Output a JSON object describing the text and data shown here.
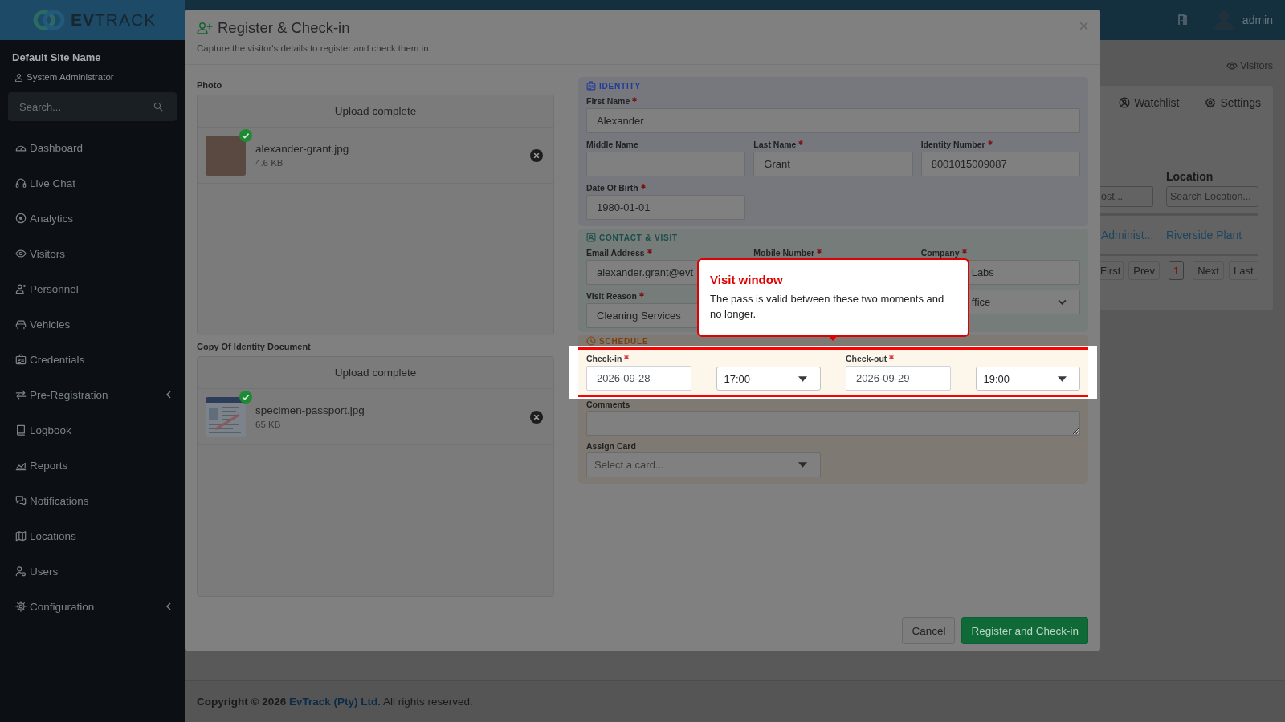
{
  "sidebar": {
    "brand": "**EV**TRACK",
    "site_name": "Default Site Name",
    "role": "System Administrator",
    "search": {
      "placeholder": "Search..."
    },
    "items": [
      {
        "label": "Dashboard",
        "selected": false,
        "expandable": false
      },
      {
        "label": "Live Chat",
        "selected": false,
        "expandable": false
      },
      {
        "label": "Analytics",
        "selected": false,
        "expandable": false
      },
      {
        "label": "Visitors",
        "selected": false,
        "expandable": false
      },
      {
        "label": "Personnel",
        "selected": false,
        "expandable": false
      },
      {
        "label": "Vehicles",
        "selected": false,
        "expandable": false
      },
      {
        "label": "Credentials",
        "selected": false,
        "expandable": false
      },
      {
        "label": "Pre-Registration",
        "selected": false,
        "expandable": true
      },
      {
        "label": "Logbook",
        "selected": false,
        "expandable": false
      },
      {
        "label": "Reports",
        "selected": false,
        "expandable": false
      },
      {
        "label": "Notifications",
        "selected": false,
        "expandable": false
      },
      {
        "label": "Locations",
        "selected": false,
        "expandable": false
      },
      {
        "label": "Users",
        "selected": false,
        "expandable": false
      },
      {
        "label": "Configuration",
        "selected": false,
        "expandable": true
      }
    ]
  },
  "topbar": {
    "user": "admin"
  },
  "page": {
    "breadcrumb": "Visitors",
    "card": {
      "tabs": [
        {
          "label": "Watchlist",
          "selected": false
        },
        {
          "label": "Settings",
          "selected": false
        }
      ],
      "filters": [
        {
          "placeholder": "ost..."
        },
        {
          "label": "Location",
          "placeholder": "Search Location..."
        }
      ],
      "row": [
        "Administ...",
        "Riverside Plant"
      ],
      "pagination": [
        {
          "label": "First",
          "selected": false,
          "disabled": true
        },
        {
          "label": "Prev",
          "selected": false,
          "disabled": true
        },
        {
          "label": "1",
          "selected": true,
          "disabled": false
        },
        {
          "label": "Next",
          "selected": false,
          "disabled": true
        },
        {
          "label": "Last",
          "selected": false,
          "disabled": true
        }
      ]
    }
  },
  "modal": {
    "title": "Register & Check-in",
    "subtitle": "Capture the visitor's details to register and check them in.",
    "uploads": [
      {
        "label": "Photo",
        "status": "Upload complete",
        "file": {
          "kind": "photo",
          "name": "alexander-grant.jpg",
          "size": "4.6 KB",
          "uploaded": true
        }
      },
      {
        "label": "Copy Of Identity Document",
        "status": "Upload complete",
        "file": {
          "kind": "document",
          "name": "specimen-passport.jpg",
          "size": "65 KB",
          "uploaded": true
        }
      }
    ],
    "sections": [
      {
        "kind": "identity",
        "title": "IDENTITY",
        "fields": [
          {
            "kind": "text",
            "label": "First Name",
            "required": true,
            "value": "Alexander"
          },
          {
            "kind": "text",
            "label": "Middle Name",
            "required": false
          },
          {
            "kind": "text",
            "label": "Last Name",
            "required": true,
            "value": "Grant"
          },
          {
            "kind": "text",
            "label": "Identity Number",
            "required": true,
            "value": "8001015009087"
          },
          {
            "kind": "text",
            "label": "Date Of Birth",
            "required": true,
            "value": "1980-01-01"
          }
        ]
      },
      {
        "kind": "contact",
        "title": "CONTACT & VISIT",
        "fields": [
          {
            "kind": "text",
            "label": "Email Address",
            "required": true,
            "value": "alexander.grant@evt"
          },
          {
            "kind": "label",
            "label": "Mobile Number",
            "required": true
          },
          {
            "kind": "covered_text",
            "label": "Company",
            "required": true,
            "value": "Labs"
          },
          {
            "kind": "text",
            "label": "Visit Reason",
            "required": true,
            "value": "Cleaning Services"
          },
          {
            "kind": "covered_select",
            "value": "ffice"
          }
        ]
      },
      {
        "kind": "schedule",
        "title": "SCHEDULE",
        "highlighted": [
          {
            "kind": "date",
            "label": "Check-in",
            "required": true,
            "value": "2026-09-28"
          },
          {
            "kind": "dropdown",
            "value": "17:00"
          },
          {
            "kind": "date",
            "label": "Check-out",
            "required": true,
            "value": "2026-09-29"
          },
          {
            "kind": "dropdown",
            "value": "19:00"
          }
        ],
        "fields": [
          {
            "kind": "textarea",
            "label": "Comments",
            "required": false
          },
          {
            "kind": "dropdown",
            "label": "Assign Card",
            "required": false,
            "placeholder": "Select a card..."
          }
        ]
      }
    ],
    "buttons": [
      {
        "kind": "secondary",
        "label": "Cancel"
      },
      {
        "kind": "primary",
        "label": "Register and Check-in"
      }
    ]
  },
  "callout": {
    "title": "Visit window",
    "text": "The pass is valid between these two moments and no longer."
  },
  "footer": {
    "lead": "Copyright © 2026",
    "link": "EvTrack (Pty) Ltd.",
    "tail": "All rights reserved."
  }
}
